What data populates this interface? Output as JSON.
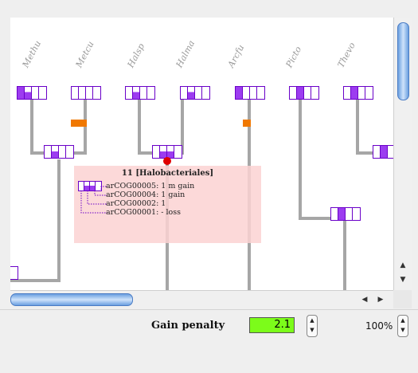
{
  "taxa": [
    "Methu",
    "Metcu",
    "Halsp",
    "Halma",
    "Arcfu",
    "Picto",
    "Thevo"
  ],
  "tooltip": {
    "title": "11 [Halobacteriales]",
    "lines": [
      "arCOG00005: 1 m gain",
      "arCOG00004: 1 gain",
      "arCOG00002: 1",
      "arCOG00001: - loss"
    ]
  },
  "toolbar": {
    "gain_penalty_label": "Gain penalty",
    "gain_penalty_value": "2.1",
    "zoom_value": "100%"
  },
  "colors": {
    "present": "#9c3cf0",
    "gain_marker": "#f07800",
    "highlight_node": "#e00000",
    "penalty_field": "#7cfc1a"
  },
  "icons": {
    "spin_up": "▲",
    "spin_down": "▼",
    "scroll_left": "◀",
    "scroll_right": "▶"
  }
}
